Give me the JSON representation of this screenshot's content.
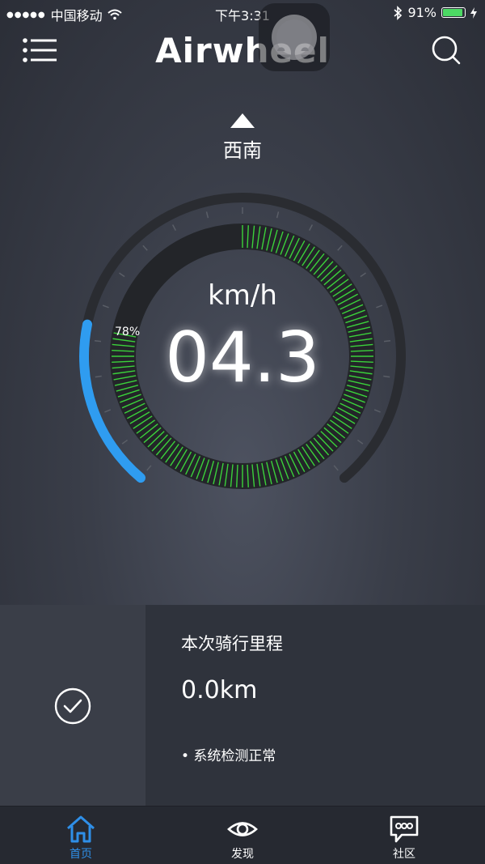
{
  "status_bar": {
    "carrier": "中国移动",
    "time": "下午3:31",
    "battery": "91%",
    "battery_level": 0.91
  },
  "header": {
    "logo": "Airwheel",
    "menu_icon": "menu-list-icon",
    "search_icon": "search-icon"
  },
  "direction": {
    "label": "西南",
    "arrow_icon": "triangle-up-icon"
  },
  "gauge": {
    "speed": "04.3",
    "unit": "km/h",
    "battery_percent_label": "78%",
    "battery_level": 0.78,
    "speed_arc_level": 0.22,
    "colors": {
      "battery_segments": "#3bd13b",
      "speed_arc": "#2f9cf0",
      "track": "#2a2c31"
    }
  },
  "trip": {
    "label": "本次骑行里程",
    "distance": "0.0km",
    "system_status": "• 系统检测正常",
    "status_icon": "check-circle-icon"
  },
  "tabs": [
    {
      "label": "首页",
      "icon": "home-icon",
      "active": true
    },
    {
      "label": "发现",
      "icon": "eye-icon",
      "active": false
    },
    {
      "label": "社区",
      "icon": "chat-bubble-icon",
      "active": false
    }
  ],
  "colors": {
    "accent": "#2f8fe8",
    "background": "#3a3e49"
  }
}
